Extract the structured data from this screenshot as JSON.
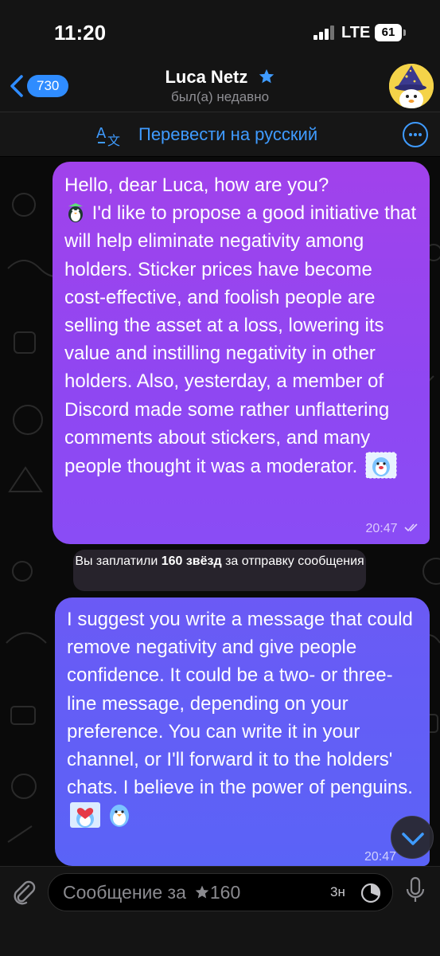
{
  "status": {
    "time": "11:20",
    "network": "LTE",
    "battery": "61"
  },
  "header": {
    "back_count": "730",
    "contact_name": "Luca Netz",
    "contact_status": "был(а) недавно",
    "icons": {
      "back": "chevron-left-icon",
      "verified": "star-icon",
      "avatar": "penguin-wizard-avatar"
    }
  },
  "translate": {
    "label": "Перевести на русский",
    "icon": "translate-icon",
    "more_icon": "ellipsis-icon"
  },
  "messages": [
    {
      "text_before_emoji": "Hello, dear Luca, how are you?",
      "text_after_emoji": " I'd like to propose a good initiative that will help eliminate negativity among holders. Sticker prices have become cost-effective, and foolish people are selling the asset at a loss, lowering its value and instilling negativity in other holders. Also, yesterday, a member of Discord made some rather unflattering comments about stickers, and many people thought it was a moderator.",
      "time": "20:47",
      "read": true
    },
    {
      "text": "I suggest you write a message that could remove negativity and give people confidence. It could be a two- or three-line message, depending on your preference. You can write it in your channel, or I'll forward it to the holders' chats. I believe in the power of penguins.",
      "time": "20:47"
    }
  ],
  "service_message": {
    "prefix": "Вы заплатили ",
    "bold": "160 звёзд",
    "suffix": " за отправку сообщения"
  },
  "composer": {
    "placeholder": "Сообщение за",
    "star_cost": "160",
    "timer_label": "3н",
    "icons": {
      "attach": "paperclip-icon",
      "timer": "timer-icon",
      "mic": "microphone-icon",
      "scroll": "chevron-down-icon"
    }
  },
  "colors": {
    "accent": "#3f9bff",
    "bubble_1": "#9a44ef",
    "bubble_2": "#6260f6",
    "background": "#0a0a0a"
  }
}
